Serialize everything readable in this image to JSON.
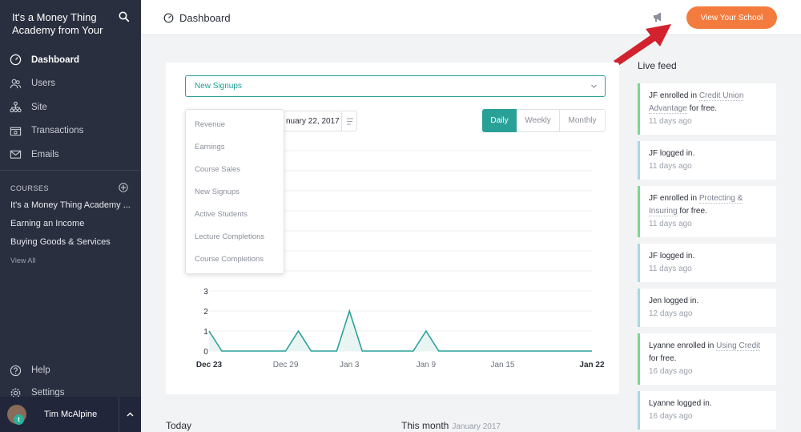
{
  "sidebar": {
    "school_title": "It's a Money Thing Academy from Your",
    "nav": [
      {
        "label": "Dashboard",
        "icon": "speedometer-icon",
        "active": true
      },
      {
        "label": "Users",
        "icon": "users-icon"
      },
      {
        "label": "Site",
        "icon": "sitemap-icon"
      },
      {
        "label": "Transactions",
        "icon": "money-icon"
      },
      {
        "label": "Emails",
        "icon": "envelope-icon"
      }
    ],
    "courses_heading": "COURSES",
    "courses": [
      "It's a Money Thing Academy ...",
      "Earning an Income",
      "Buying Goods & Services"
    ],
    "view_all": "View All",
    "bottom_nav": [
      {
        "label": "Help",
        "icon": "question-icon"
      },
      {
        "label": "Settings",
        "icon": "gear-icon"
      }
    ],
    "user": {
      "name": "Tim McAlpine",
      "badge": "t"
    }
  },
  "topbar": {
    "title": "Dashboard",
    "view_school_label": "View Your School",
    "accent": "#f47b3e"
  },
  "dashboard": {
    "metric_selected": "New Signups",
    "date_range_visible": "nuary 22, 2017",
    "metric_options": [
      "Revenue",
      "Earnings",
      "Course Sales",
      "New Signups",
      "Active Students",
      "Lecture Completions",
      "Course Completions"
    ],
    "granularity": [
      {
        "label": "Daily",
        "active": true
      },
      {
        "label": "Weekly"
      },
      {
        "label": "Monthly"
      }
    ]
  },
  "chart_data": {
    "type": "area",
    "y_ticks": [
      "0",
      "1",
      "2",
      "3"
    ],
    "x_ticks": [
      "Dec 23",
      "Dec 29",
      "Jan 3",
      "Jan 9",
      "Jan 15",
      "Jan 22"
    ],
    "x_tick_days": [
      0,
      6,
      11,
      17,
      23,
      30
    ],
    "series": [
      {
        "values": [
          1,
          0,
          0,
          0,
          0,
          0,
          0,
          1,
          0,
          0,
          0,
          2,
          0,
          0,
          0,
          0,
          0,
          1,
          0,
          0,
          0,
          0,
          0,
          0,
          0,
          0,
          0,
          0,
          0,
          0,
          0
        ]
      }
    ],
    "ylim": [
      0,
      3
    ],
    "grid": true,
    "color": "#2aa198"
  },
  "bottom": {
    "today": "Today",
    "this_month": "This month",
    "this_month_sub": "January 2017"
  },
  "live_feed": {
    "title": "Live feed",
    "items": [
      {
        "type": "enroll",
        "pre": "JF enrolled in ",
        "link": "Credit Union Advantage",
        "post": " for free.",
        "ago": "11 days ago"
      },
      {
        "type": "login",
        "pre": "JF logged in.",
        "link": "",
        "post": "",
        "ago": "11 days ago"
      },
      {
        "type": "enroll",
        "pre": "JF enrolled in ",
        "link": "Protecting & Insuring",
        "post": " for free.",
        "ago": "11 days ago"
      },
      {
        "type": "login",
        "pre": "JF logged in.",
        "link": "",
        "post": "",
        "ago": "11 days ago"
      },
      {
        "type": "login",
        "pre": "Jen logged in.",
        "link": "",
        "post": "",
        "ago": "12 days ago"
      },
      {
        "type": "enroll",
        "pre": "Lyanne enrolled in ",
        "link": "Using Credit",
        "post": " for free.",
        "ago": "16 days ago"
      },
      {
        "type": "login",
        "pre": "Lyanne logged in.",
        "link": "",
        "post": "",
        "ago": "16 days ago"
      }
    ]
  }
}
